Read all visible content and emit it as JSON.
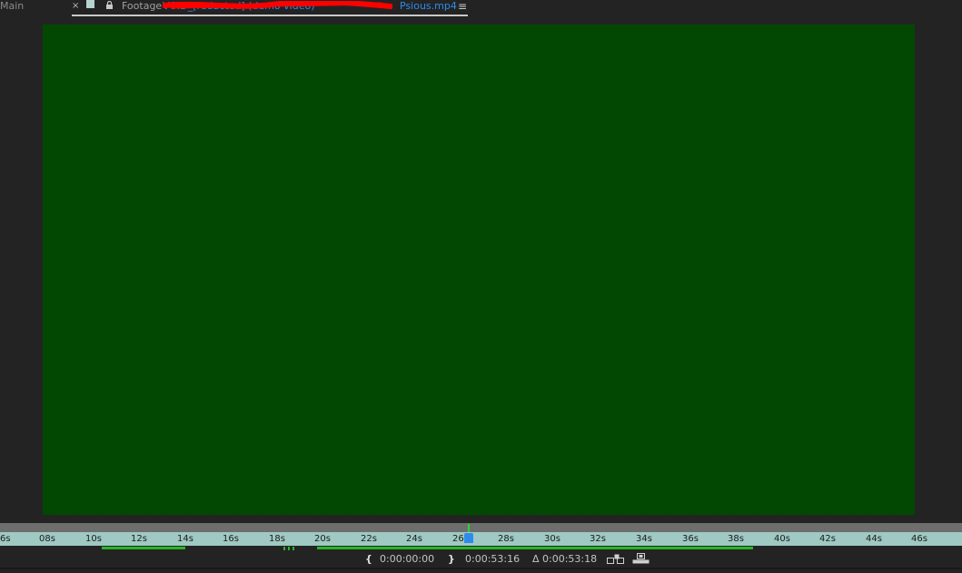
{
  "panel_tabs": {
    "main_label": "Main",
    "close_glyph": "×",
    "footage_label": "Footage",
    "file_name_redacted": "VOID_[redacted] (demo video)",
    "file_name": "Psious.mp4",
    "menu_glyph": "≡"
  },
  "viewer": {
    "footage_color": "#024802"
  },
  "timeline_ruler": {
    "tick_labels": [
      "6s",
      "08s",
      "10s",
      "12s",
      "14s",
      "16s",
      "18s",
      "20s",
      "22s",
      "24s",
      "26s",
      "28s",
      "30s",
      "32s",
      "34s",
      "36s",
      "38s",
      "40s",
      "42s",
      "44s",
      "46s"
    ],
    "ruler_color": "#9fc9c2",
    "cache_color": "#25b825",
    "playhead_color": "#2d8ceb"
  },
  "status_bar": {
    "in_point_glyph": "{",
    "in_point": "0:00:00:00",
    "out_point_glyph": "}",
    "out_point": "0:00:53:16",
    "duration_symbol": "Δ",
    "duration": "0:00:53:18",
    "icons": [
      "ripple-insert-edit-icon",
      "overlay-edit-icon"
    ]
  }
}
